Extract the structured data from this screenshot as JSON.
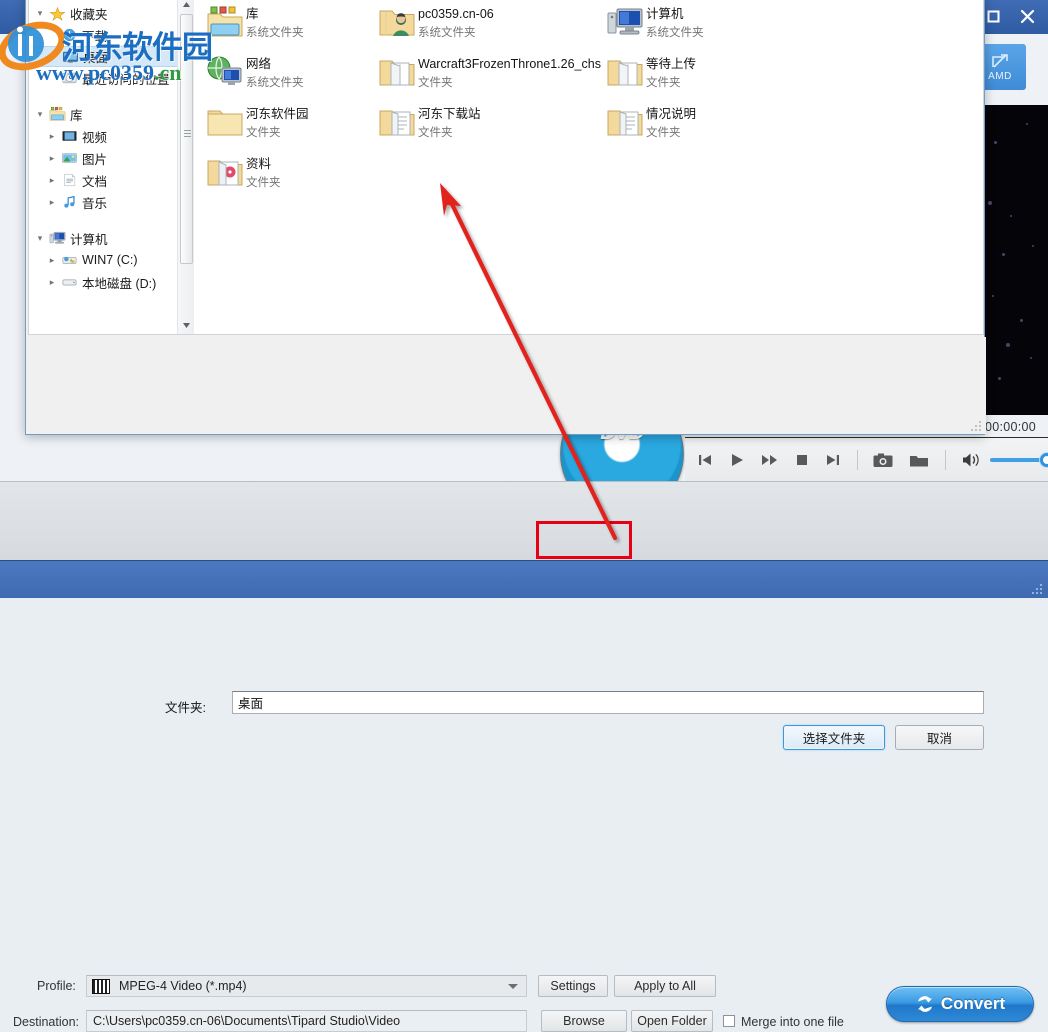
{
  "app": {
    "title_bar": {
      "maximize_label": "Maximize",
      "close_label": "Close"
    },
    "amd_badge": {
      "label": "AMD"
    },
    "preview": {
      "timestamp": "00:00:00"
    },
    "player_controls": [
      {
        "name": "previous",
        "label": "Previous"
      },
      {
        "name": "play",
        "label": "Play"
      },
      {
        "name": "fast-forward",
        "label": "Fast Forward"
      },
      {
        "name": "stop",
        "label": "Stop"
      },
      {
        "name": "next",
        "label": "Next"
      },
      {
        "name": "snapshot",
        "label": "Snapshot"
      },
      {
        "name": "open-folder",
        "label": "Open Snapshot Folder"
      },
      {
        "name": "volume",
        "label": "Volume"
      }
    ],
    "bottom": {
      "profile_label": "Profile:",
      "profile_value": "MPEG-4 Video (*.mp4)",
      "profile_icon": "mpeg-film-icon",
      "destination_label": "Destination:",
      "destination_value": "C:\\Users\\pc0359.cn-06\\Documents\\Tipard Studio\\Video",
      "settings_label": "Settings",
      "apply_to_all_label": "Apply to All",
      "browse_label": "Browse",
      "open_folder_label": "Open Folder",
      "merge_label": "Merge into one file",
      "merge_checked": false,
      "convert_label": "Convert"
    },
    "colors": {
      "accent": "#3f6cb4",
      "convert": "#2f8ad6",
      "annotation": "#e60012"
    }
  },
  "dialog": {
    "nav": {
      "sections": [
        {
          "header": {
            "label": "收藏夹",
            "icon": "star-icon",
            "expander": "expanded"
          },
          "items": [
            {
              "label": "下载",
              "icon": "download-icon",
              "selected": false,
              "expander": ""
            },
            {
              "label": "桌面",
              "icon": "desktop-icon",
              "selected": true,
              "expander": ""
            },
            {
              "label": "最近访问的位置",
              "icon": "recent-places-icon",
              "selected": false,
              "expander": ""
            }
          ]
        },
        {
          "header": {
            "label": "库",
            "icon": "library-icon",
            "expander": "expanded"
          },
          "items": [
            {
              "label": "视频",
              "icon": "videos-icon",
              "selected": false,
              "expander": "collapsed"
            },
            {
              "label": "图片",
              "icon": "pictures-icon",
              "selected": false,
              "expander": "collapsed"
            },
            {
              "label": "文档",
              "icon": "documents-icon",
              "selected": false,
              "expander": "collapsed"
            },
            {
              "label": "音乐",
              "icon": "music-icon",
              "selected": false,
              "expander": "collapsed"
            }
          ]
        },
        {
          "header": {
            "label": "计算机",
            "icon": "computer-icon",
            "expander": "expanded"
          },
          "items": [
            {
              "label": "WIN7 (C:)",
              "icon": "system-drive-icon",
              "selected": false,
              "expander": "collapsed"
            },
            {
              "label": "本地磁盘 (D:)",
              "icon": "drive-icon",
              "selected": false,
              "expander": "collapsed"
            }
          ]
        }
      ]
    },
    "files": [
      {
        "name": "库",
        "type": "系统文件夹",
        "icon": "library-folder-icon",
        "col": 0,
        "row": 0
      },
      {
        "name": "pc0359.cn-06",
        "type": "系统文件夹",
        "icon": "user-folder-icon",
        "col": 1,
        "row": 0
      },
      {
        "name": "计算机",
        "type": "系统文件夹",
        "icon": "computer-icon",
        "col": 2,
        "row": 0
      },
      {
        "name": "网络",
        "type": "系统文件夹",
        "icon": "network-icon",
        "col": 0,
        "row": 1
      },
      {
        "name": "Warcraft3FrozenThrone1.26_chs",
        "type": "文件夹",
        "icon": "open-folder-icon",
        "col": 1,
        "row": 1
      },
      {
        "name": "等待上传",
        "type": "文件夹",
        "icon": "open-folder-icon",
        "col": 2,
        "row": 1
      },
      {
        "name": "河东软件园",
        "type": "文件夹",
        "icon": "folder-icon",
        "col": 0,
        "row": 2
      },
      {
        "name": "河东下载站",
        "type": "文件夹",
        "icon": "docs-folder-icon",
        "col": 1,
        "row": 2
      },
      {
        "name": "情况说明",
        "type": "文件夹",
        "icon": "docs-folder-icon",
        "col": 2,
        "row": 2
      },
      {
        "name": "资料",
        "type": "文件夹",
        "icon": "media-folder-icon",
        "col": 0,
        "row": 3
      }
    ],
    "folder_label": "文件夹:",
    "folder_value": "桌面",
    "select_label": "选择文件夹",
    "cancel_label": "取消"
  },
  "watermark": {
    "cn": "河东软件园",
    "url_prefix": "www.pc0359",
    "url_suffix": ".cn"
  }
}
